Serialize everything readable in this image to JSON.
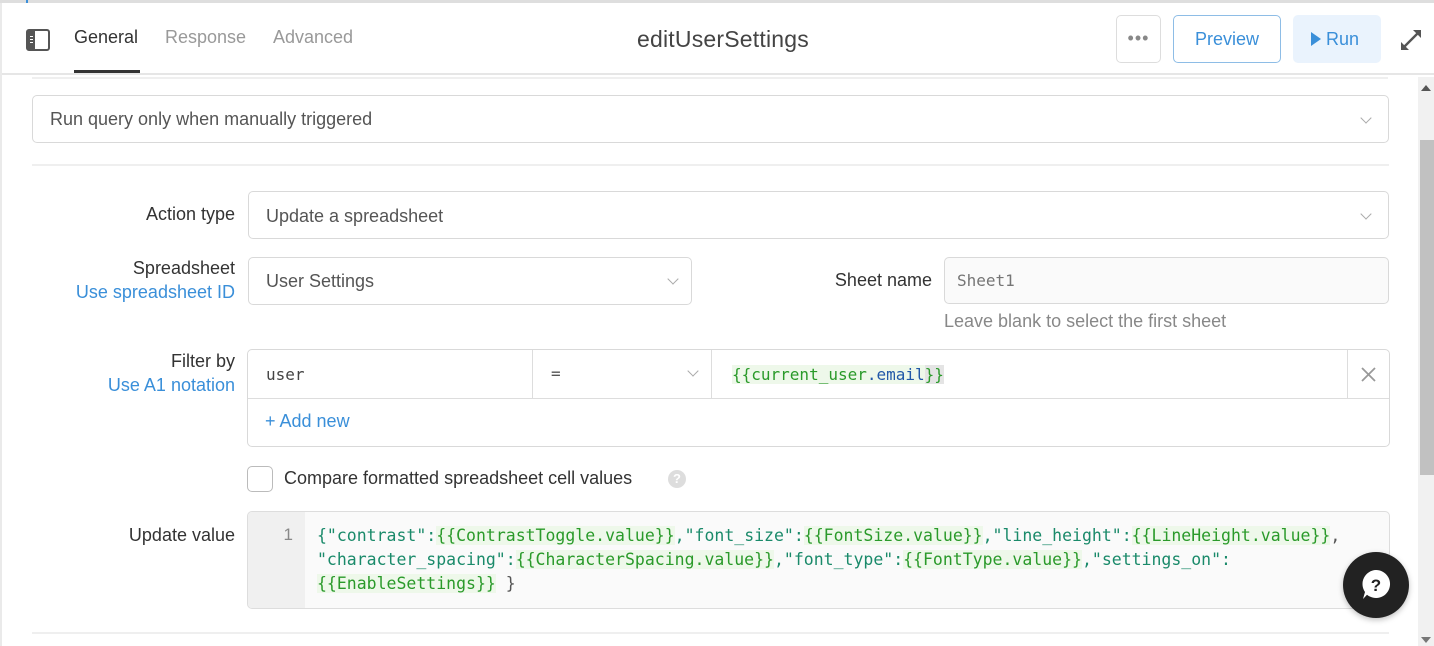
{
  "header": {
    "tabs": [
      {
        "label": "General",
        "active": true
      },
      {
        "label": "Response",
        "active": false
      },
      {
        "label": "Advanced",
        "active": false
      }
    ],
    "title": "editUserSettings",
    "more_label": "•••",
    "preview_label": "Preview",
    "run_label": "Run"
  },
  "trigger": {
    "value": "Run query only when manually triggered"
  },
  "action_type": {
    "label": "Action type",
    "value": "Update a spreadsheet"
  },
  "spreadsheet": {
    "label": "Spreadsheet",
    "link": "Use spreadsheet ID",
    "value": "User Settings"
  },
  "sheet_name": {
    "label": "Sheet name",
    "placeholder": "Sheet1",
    "hint": "Leave blank to select the first sheet"
  },
  "filter": {
    "label": "Filter by",
    "link": "Use A1 notation",
    "rows": [
      {
        "column": "user",
        "operator": "=",
        "value_open": "{{",
        "value_obj": "current_user",
        "value_dot": ".",
        "value_prop": "email",
        "value_close": "}}"
      }
    ],
    "add_label": "+ Add new"
  },
  "compare": {
    "label": "Compare formatted spreadsheet cell values",
    "checked": false,
    "help": "?"
  },
  "update_value": {
    "label": "Update value",
    "line_number": "1",
    "tokens": {
      "t1": "{\"contrast\":",
      "t2o": "{{ContrastToggle.",
      "t2p": "value",
      "t2c": "}}",
      "t3": ",\"font_size\":",
      "t4o": "{{FontSize.",
      "t4p": "value",
      "t4c": "}}",
      "t5": ",\"line_height\":",
      "t6o": "{{LineHeight.",
      "t6p": "value",
      "t6c": "}}",
      "t7": ",",
      "t8": "\"character_spacing\":",
      "t9o": "{{CharacterSpacing.",
      "t9p": "value",
      "t9c": "}}",
      "t10": ",\"font_type\":",
      "t11o": "{{FontType.",
      "t11p": "value",
      "t11c": "}}",
      "t12": ",\"settings_on\":",
      "t13": "{{EnableSettings}}",
      "t14": " }"
    }
  },
  "help_fab": {
    "label": "?"
  },
  "colors": {
    "accent": "#3a8fd9",
    "run_bg": "#eaf3fd",
    "template_bg": "#eef8ea",
    "template_text": "#2a9a2a",
    "property_text": "#2158a8"
  }
}
